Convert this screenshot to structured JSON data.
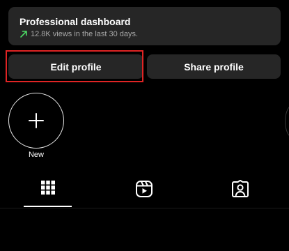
{
  "dashboard": {
    "title": "Professional dashboard",
    "stats": "12.8K views in the last 30 days.",
    "trend_icon": "trend-up-arrow-icon",
    "trend_color": "#4cd964"
  },
  "actions": {
    "edit_label": "Edit profile",
    "share_label": "Share profile",
    "highlight_color": "#e02424"
  },
  "highlights": {
    "new_label": "New",
    "new_icon": "plus-icon"
  },
  "tabs": [
    {
      "name": "posts-grid",
      "icon": "grid-icon",
      "active": true
    },
    {
      "name": "reels",
      "icon": "reels-icon",
      "active": false
    },
    {
      "name": "tagged",
      "icon": "tagged-person-icon",
      "active": false
    }
  ]
}
